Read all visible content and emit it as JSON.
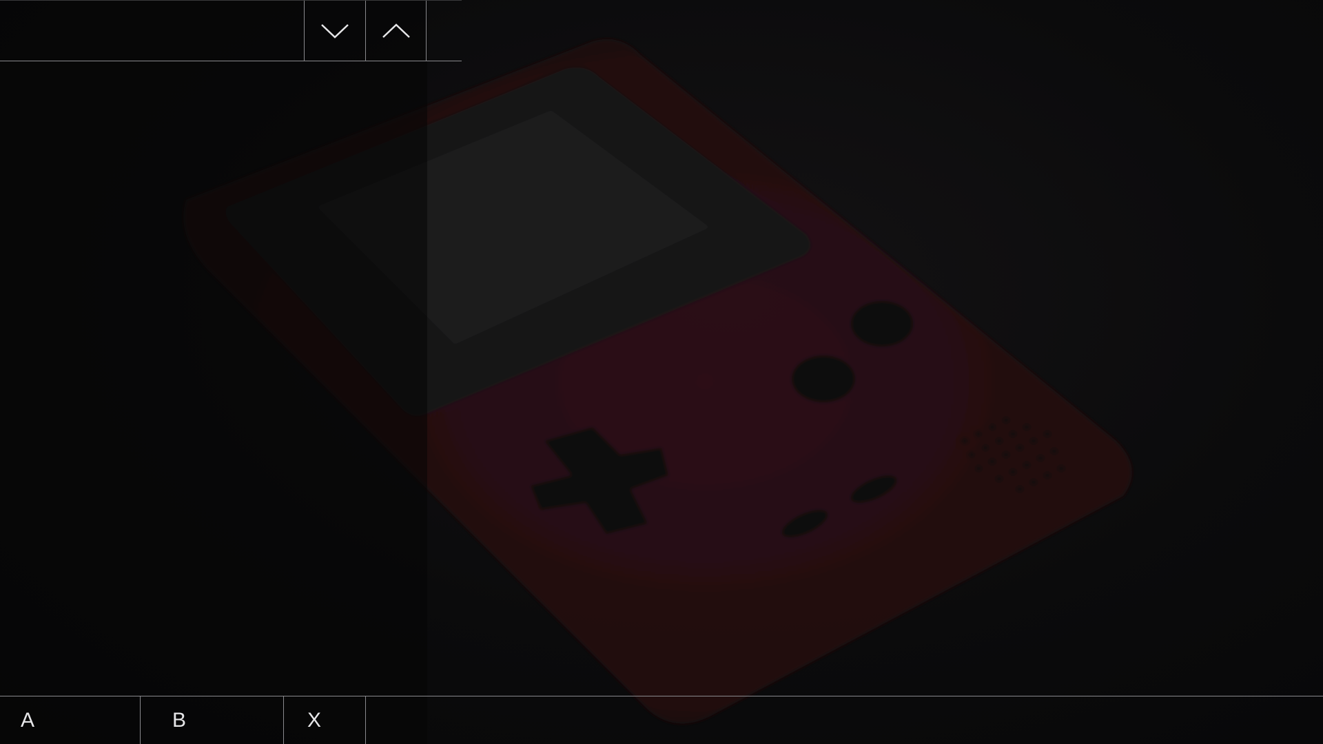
{
  "topbar": {
    "title": "",
    "scroll_down_icon": "chevron-down-icon",
    "scroll_up_icon": "chevron-up-icon"
  },
  "background": {
    "subject": "handheld-console-photo",
    "console_color": "#3a1418"
  },
  "bottombar": {
    "buttons": [
      {
        "label": "A"
      },
      {
        "label": "B"
      },
      {
        "label": "X"
      }
    ]
  },
  "colors": {
    "line": "#8a8a8e",
    "text": "#e6e6e8",
    "background": "#0a0a0b"
  }
}
